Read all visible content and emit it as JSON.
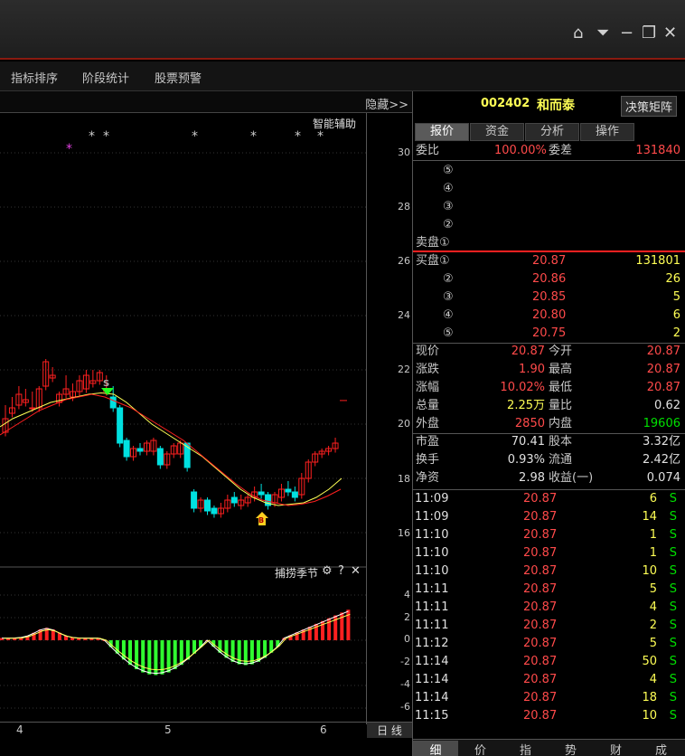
{
  "window": {
    "controls": [
      "home-icon",
      "dropdown-icon",
      "minimize-icon",
      "restore-icon",
      "close-icon"
    ]
  },
  "menu": {
    "items": [
      "指标排序",
      "阶段统计",
      "股票预警"
    ]
  },
  "chart": {
    "hide_label": "隐藏>>",
    "assist_label": "智能辅助",
    "y_ticks": [
      "30",
      "28",
      "26",
      "24",
      "22",
      "20",
      "18",
      "16"
    ],
    "indicator_title": "捕捞季节",
    "indicator_ticks": [
      "4",
      "2",
      "0",
      "-2",
      "-4",
      "-6"
    ],
    "x_labels": [
      "4",
      "5",
      "6"
    ],
    "period_label": "日 线",
    "sell_marker": "S",
    "buy_marker": "B"
  },
  "quote": {
    "code": "002402",
    "name": "和而泰",
    "decision_btn": "决策矩阵",
    "tabs": [
      "报价",
      "资金",
      "分析",
      "操作"
    ],
    "weibi_label": "委比",
    "weibi_value": "100.00%",
    "weicha_label": "委差",
    "weicha_value": "131840",
    "sell": [
      {
        "label": "⑤"
      },
      {
        "label": "④"
      },
      {
        "label": "③"
      },
      {
        "label": "②"
      },
      {
        "label": "卖盘①"
      }
    ],
    "buy": [
      {
        "label": "买盘①",
        "price": "20.87",
        "vol": "131801"
      },
      {
        "label": "②",
        "price": "20.86",
        "vol": "26"
      },
      {
        "label": "③",
        "price": "20.85",
        "vol": "5"
      },
      {
        "label": "④",
        "price": "20.80",
        "vol": "6"
      },
      {
        "label": "⑤",
        "price": "20.75",
        "vol": "2"
      }
    ],
    "stats": [
      {
        "l1": "现价",
        "v1": "20.87",
        "l2": "今开",
        "v2": "20.87"
      },
      {
        "l1": "涨跌",
        "v1": "1.90",
        "l2": "最高",
        "v2": "20.87"
      },
      {
        "l1": "涨幅",
        "v1": "10.02%",
        "l2": "最低",
        "v2": "20.87"
      },
      {
        "l1": "总量",
        "v1": "2.25万",
        "l2": "量比",
        "v2": "0.62"
      },
      {
        "l1": "外盘",
        "v1": "2850",
        "l2": "内盘",
        "v2": "19606"
      }
    ],
    "fin": [
      {
        "l1": "市盈",
        "v1": "70.41",
        "l2": "股本",
        "v2": "3.32亿"
      },
      {
        "l1": "换手",
        "v1": "0.93%",
        "l2": "流通",
        "v2": "2.42亿"
      },
      {
        "l1": "净资",
        "v1": "2.98",
        "l2": "收益(一)",
        "v2": "0.074"
      }
    ],
    "ticks": [
      {
        "t": "11:09",
        "p": "20.87",
        "v": "6",
        "s": "S"
      },
      {
        "t": "11:09",
        "p": "20.87",
        "v": "14",
        "s": "S"
      },
      {
        "t": "11:10",
        "p": "20.87",
        "v": "1",
        "s": "S"
      },
      {
        "t": "11:10",
        "p": "20.87",
        "v": "1",
        "s": "S"
      },
      {
        "t": "11:10",
        "p": "20.87",
        "v": "10",
        "s": "S"
      },
      {
        "t": "11:11",
        "p": "20.87",
        "v": "5",
        "s": "S"
      },
      {
        "t": "11:11",
        "p": "20.87",
        "v": "4",
        "s": "S"
      },
      {
        "t": "11:11",
        "p": "20.87",
        "v": "2",
        "s": "S"
      },
      {
        "t": "11:12",
        "p": "20.87",
        "v": "5",
        "s": "S"
      },
      {
        "t": "11:14",
        "p": "20.87",
        "v": "50",
        "s": "S"
      },
      {
        "t": "11:14",
        "p": "20.87",
        "v": "4",
        "s": "S"
      },
      {
        "t": "11:14",
        "p": "20.87",
        "v": "18",
        "s": "S"
      },
      {
        "t": "11:15",
        "p": "20.87",
        "v": "10",
        "s": "S"
      }
    ],
    "bottom_tabs": [
      "细",
      "价",
      "指",
      "势",
      "财",
      "成"
    ]
  },
  "colors": {
    "up": "#ff2020",
    "down": "#00e0e0",
    "ma1": "#ffff55",
    "ma2": "#ff2020",
    "bar_pos": "#ff2020",
    "bar_neg": "#30ff30"
  }
}
